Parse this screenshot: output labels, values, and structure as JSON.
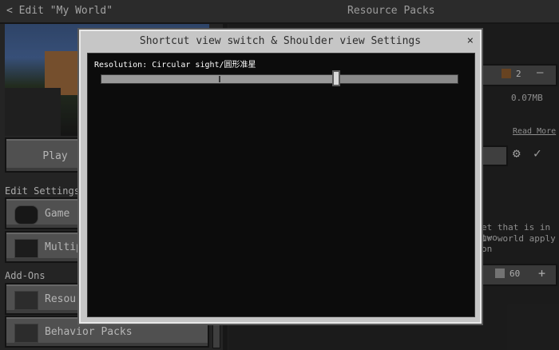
{
  "header": {
    "back_label": "< Edit \"My World\"",
    "title": "Resource Packs"
  },
  "left": {
    "play_label": "Play",
    "edit_settings_label": "Edit Settings",
    "settings_items": [
      {
        "label": "Game",
        "icon": "gamepad-icon"
      },
      {
        "label": "Multipl",
        "icon": "players-icon"
      }
    ],
    "addons_label": "Add-Ons",
    "addon_items": [
      {
        "label": "Resou",
        "icon": "pack-icon"
      },
      {
        "label": "Behavior Packs",
        "icon": "pack-icon"
      }
    ]
  },
  "right": {
    "count_top": "2",
    "size": "0.07MB",
    "read_more": "Read More",
    "body_line1": "et that is in two",
    "body_line2": "ur world apply on",
    "count_bottom": "60"
  },
  "modal": {
    "title": "Shortcut view switch & Shoulder view Settings",
    "close_symbol": "×",
    "resolution_label": "Resolution: Circular sight/圆形准星",
    "slider_value_fraction": 0.66,
    "slider_mark_fraction": 0.33
  },
  "colors": {
    "modal_frame": "#c6c6c6",
    "modal_body": "#0c0c0c",
    "button": "#6b6b6b"
  }
}
